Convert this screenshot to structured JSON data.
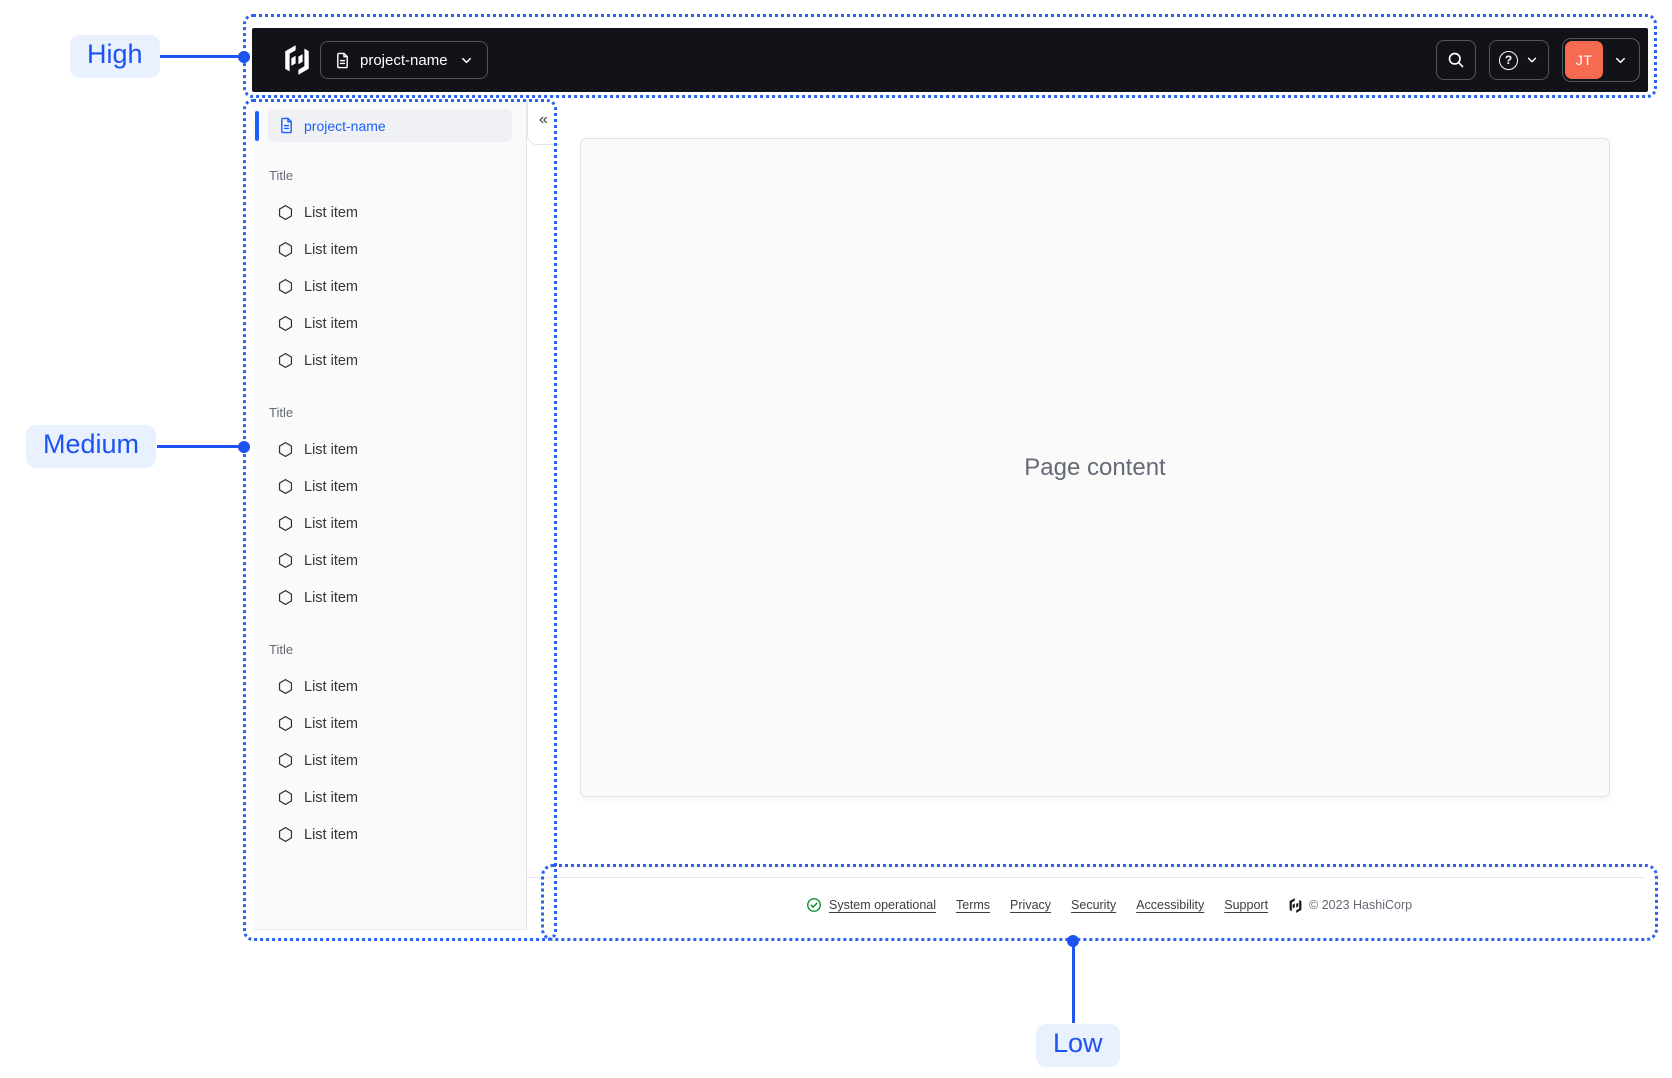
{
  "colors": {
    "accent": "#1d53ef",
    "outline_blue": "#2b62f1",
    "label_bg": "#e9f1fe",
    "avatar_bg": "#f56a50",
    "link_blue": "#1c61fb",
    "status_green": "#008a22"
  },
  "annotations": {
    "high": "High",
    "medium": "Medium",
    "low": "Low"
  },
  "header": {
    "project_switcher": "project-name",
    "help_glyph": "?",
    "avatar_initials": "JT"
  },
  "sidebar": {
    "selected_project": "project-name",
    "collapse_glyph": "«",
    "sections": [
      {
        "title": "Title",
        "items": [
          "List item",
          "List item",
          "List item",
          "List item",
          "List item"
        ]
      },
      {
        "title": "Title",
        "items": [
          "List item",
          "List item",
          "List item",
          "List item",
          "List item"
        ]
      },
      {
        "title": "Title",
        "items": [
          "List item",
          "List item",
          "List item",
          "List item",
          "List item"
        ]
      }
    ]
  },
  "main": {
    "placeholder": "Page content"
  },
  "footer": {
    "status_label": "System operational",
    "links": [
      "Terms",
      "Privacy",
      "Security",
      "Accessibility",
      "Support"
    ],
    "copyright": "© 2023 HashiCorp"
  }
}
